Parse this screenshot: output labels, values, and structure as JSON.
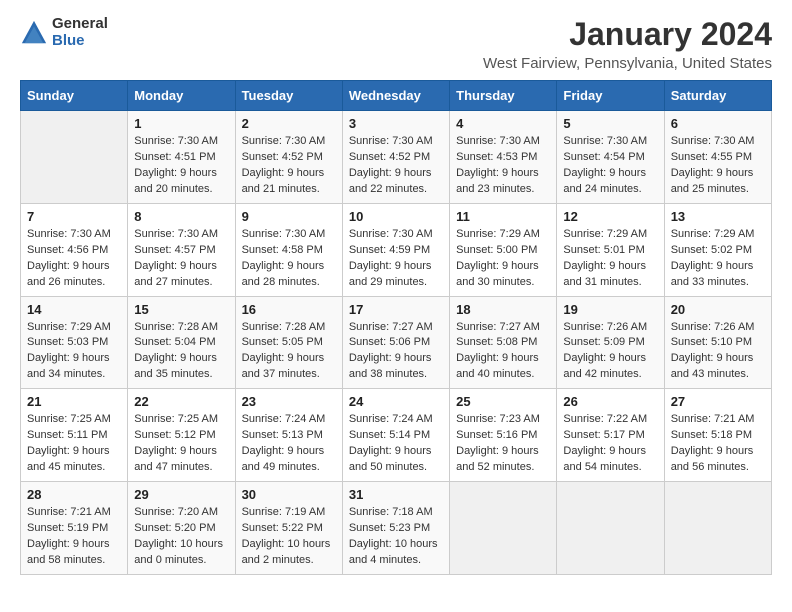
{
  "header": {
    "logo_general": "General",
    "logo_blue": "Blue",
    "month_title": "January 2024",
    "location": "West Fairview, Pennsylvania, United States"
  },
  "days_of_week": [
    "Sunday",
    "Monday",
    "Tuesday",
    "Wednesday",
    "Thursday",
    "Friday",
    "Saturday"
  ],
  "weeks": [
    [
      {
        "day": "",
        "info": ""
      },
      {
        "day": "1",
        "info": "Sunrise: 7:30 AM\nSunset: 4:51 PM\nDaylight: 9 hours\nand 20 minutes."
      },
      {
        "day": "2",
        "info": "Sunrise: 7:30 AM\nSunset: 4:52 PM\nDaylight: 9 hours\nand 21 minutes."
      },
      {
        "day": "3",
        "info": "Sunrise: 7:30 AM\nSunset: 4:52 PM\nDaylight: 9 hours\nand 22 minutes."
      },
      {
        "day": "4",
        "info": "Sunrise: 7:30 AM\nSunset: 4:53 PM\nDaylight: 9 hours\nand 23 minutes."
      },
      {
        "day": "5",
        "info": "Sunrise: 7:30 AM\nSunset: 4:54 PM\nDaylight: 9 hours\nand 24 minutes."
      },
      {
        "day": "6",
        "info": "Sunrise: 7:30 AM\nSunset: 4:55 PM\nDaylight: 9 hours\nand 25 minutes."
      }
    ],
    [
      {
        "day": "7",
        "info": "Sunrise: 7:30 AM\nSunset: 4:56 PM\nDaylight: 9 hours\nand 26 minutes."
      },
      {
        "day": "8",
        "info": "Sunrise: 7:30 AM\nSunset: 4:57 PM\nDaylight: 9 hours\nand 27 minutes."
      },
      {
        "day": "9",
        "info": "Sunrise: 7:30 AM\nSunset: 4:58 PM\nDaylight: 9 hours\nand 28 minutes."
      },
      {
        "day": "10",
        "info": "Sunrise: 7:30 AM\nSunset: 4:59 PM\nDaylight: 9 hours\nand 29 minutes."
      },
      {
        "day": "11",
        "info": "Sunrise: 7:29 AM\nSunset: 5:00 PM\nDaylight: 9 hours\nand 30 minutes."
      },
      {
        "day": "12",
        "info": "Sunrise: 7:29 AM\nSunset: 5:01 PM\nDaylight: 9 hours\nand 31 minutes."
      },
      {
        "day": "13",
        "info": "Sunrise: 7:29 AM\nSunset: 5:02 PM\nDaylight: 9 hours\nand 33 minutes."
      }
    ],
    [
      {
        "day": "14",
        "info": "Sunrise: 7:29 AM\nSunset: 5:03 PM\nDaylight: 9 hours\nand 34 minutes."
      },
      {
        "day": "15",
        "info": "Sunrise: 7:28 AM\nSunset: 5:04 PM\nDaylight: 9 hours\nand 35 minutes."
      },
      {
        "day": "16",
        "info": "Sunrise: 7:28 AM\nSunset: 5:05 PM\nDaylight: 9 hours\nand 37 minutes."
      },
      {
        "day": "17",
        "info": "Sunrise: 7:27 AM\nSunset: 5:06 PM\nDaylight: 9 hours\nand 38 minutes."
      },
      {
        "day": "18",
        "info": "Sunrise: 7:27 AM\nSunset: 5:08 PM\nDaylight: 9 hours\nand 40 minutes."
      },
      {
        "day": "19",
        "info": "Sunrise: 7:26 AM\nSunset: 5:09 PM\nDaylight: 9 hours\nand 42 minutes."
      },
      {
        "day": "20",
        "info": "Sunrise: 7:26 AM\nSunset: 5:10 PM\nDaylight: 9 hours\nand 43 minutes."
      }
    ],
    [
      {
        "day": "21",
        "info": "Sunrise: 7:25 AM\nSunset: 5:11 PM\nDaylight: 9 hours\nand 45 minutes."
      },
      {
        "day": "22",
        "info": "Sunrise: 7:25 AM\nSunset: 5:12 PM\nDaylight: 9 hours\nand 47 minutes."
      },
      {
        "day": "23",
        "info": "Sunrise: 7:24 AM\nSunset: 5:13 PM\nDaylight: 9 hours\nand 49 minutes."
      },
      {
        "day": "24",
        "info": "Sunrise: 7:24 AM\nSunset: 5:14 PM\nDaylight: 9 hours\nand 50 minutes."
      },
      {
        "day": "25",
        "info": "Sunrise: 7:23 AM\nSunset: 5:16 PM\nDaylight: 9 hours\nand 52 minutes."
      },
      {
        "day": "26",
        "info": "Sunrise: 7:22 AM\nSunset: 5:17 PM\nDaylight: 9 hours\nand 54 minutes."
      },
      {
        "day": "27",
        "info": "Sunrise: 7:21 AM\nSunset: 5:18 PM\nDaylight: 9 hours\nand 56 minutes."
      }
    ],
    [
      {
        "day": "28",
        "info": "Sunrise: 7:21 AM\nSunset: 5:19 PM\nDaylight: 9 hours\nand 58 minutes."
      },
      {
        "day": "29",
        "info": "Sunrise: 7:20 AM\nSunset: 5:20 PM\nDaylight: 10 hours\nand 0 minutes."
      },
      {
        "day": "30",
        "info": "Sunrise: 7:19 AM\nSunset: 5:22 PM\nDaylight: 10 hours\nand 2 minutes."
      },
      {
        "day": "31",
        "info": "Sunrise: 7:18 AM\nSunset: 5:23 PM\nDaylight: 10 hours\nand 4 minutes."
      },
      {
        "day": "",
        "info": ""
      },
      {
        "day": "",
        "info": ""
      },
      {
        "day": "",
        "info": ""
      }
    ]
  ]
}
